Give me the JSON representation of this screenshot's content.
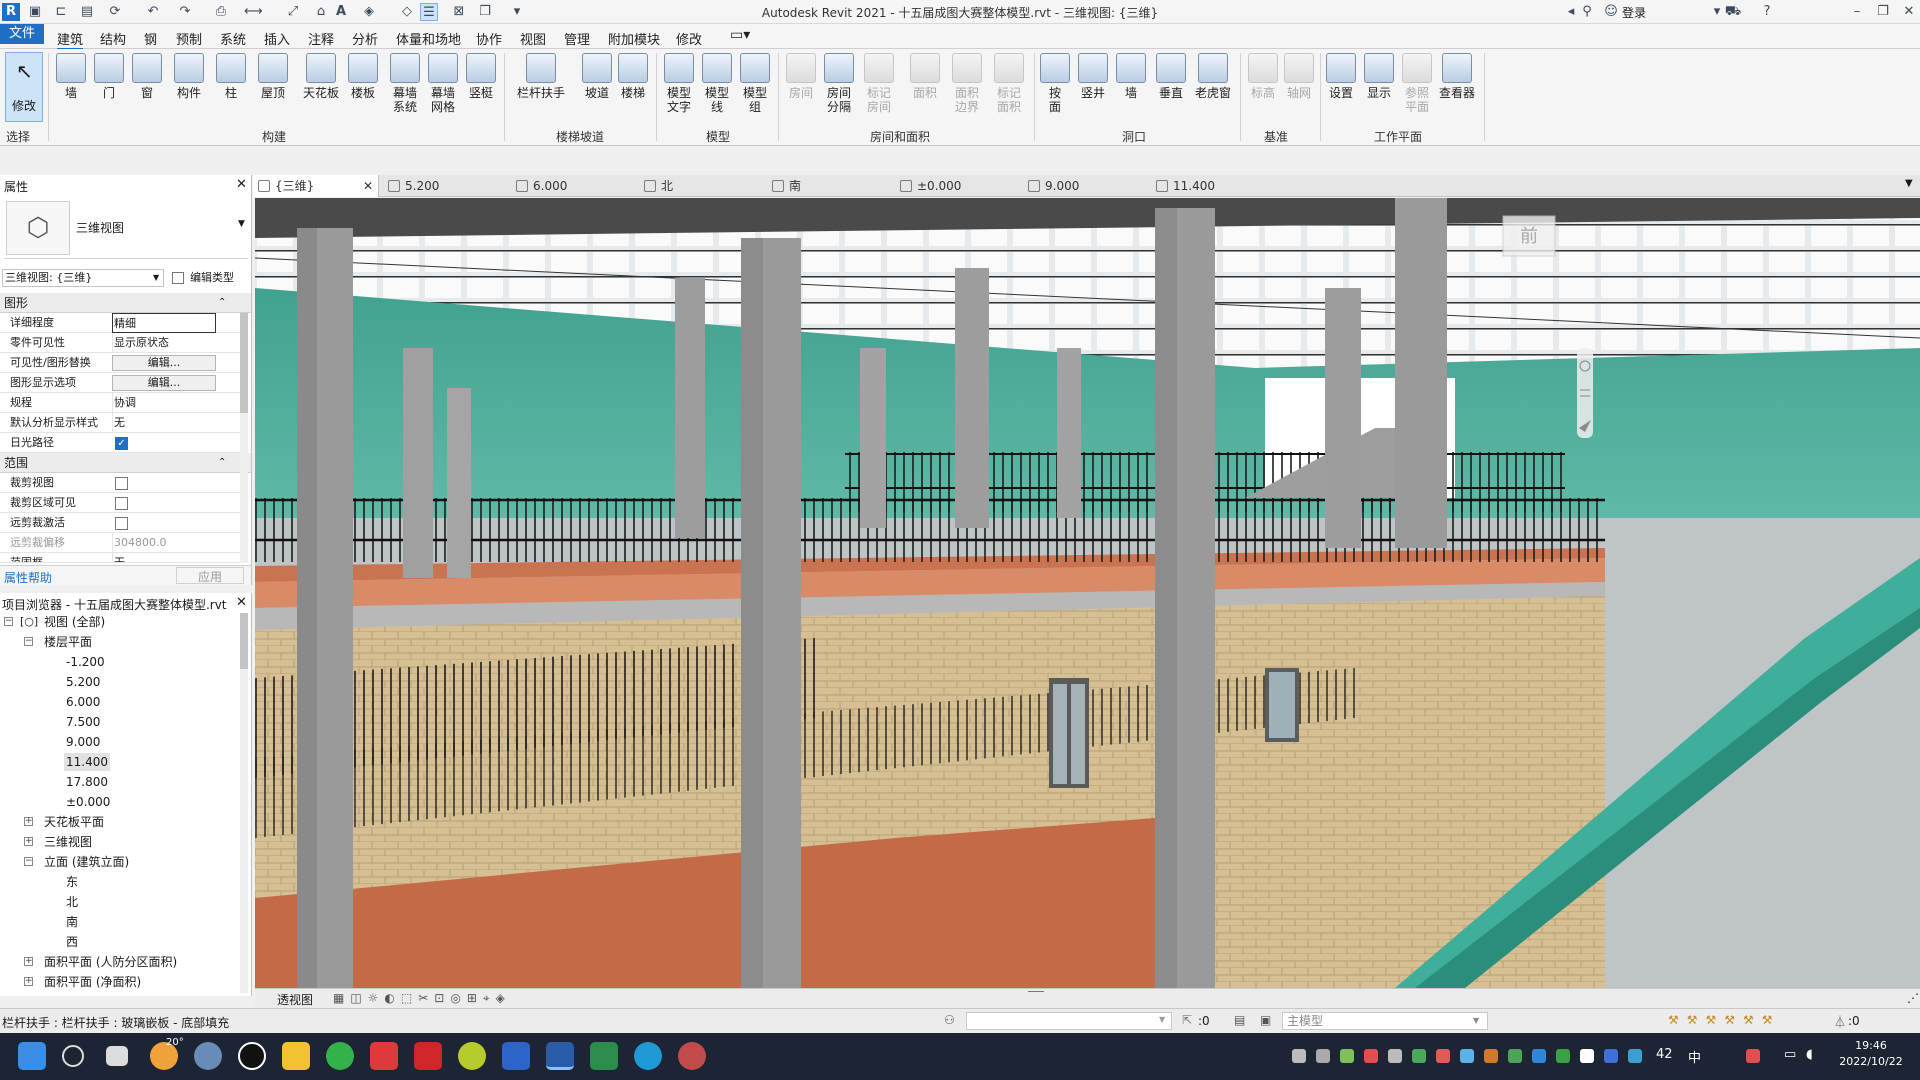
{
  "window": {
    "title": "Autodesk Revit 2021 - 十五届成图大赛整体模型.rvt - 三维视图: {三维}",
    "login_label": "登录"
  },
  "menu": {
    "file": "文件",
    "items": [
      "建筑",
      "结构",
      "钢",
      "预制",
      "系统",
      "插入",
      "注释",
      "分析",
      "体量和场地",
      "协作",
      "视图",
      "管理",
      "附加模块",
      "修改"
    ]
  },
  "ribbon": {
    "modify": "修改",
    "select_label": "选择",
    "buttons": [
      "墙",
      "门",
      "窗",
      "构件",
      "柱",
      "屋顶",
      "天花板",
      "楼板",
      "幕墙\n系统",
      "幕墙\n网格",
      "竖梃",
      "栏杆扶手",
      "坡道",
      "楼梯",
      "模型\n文字",
      "模型\n线",
      "模型\n组",
      "房间",
      "房间\n分隔",
      "标记\n房间",
      "面积",
      "面积\n边界",
      "标记\n面积",
      "按\n面",
      "竖井",
      "墙",
      "垂直",
      "老虎窗",
      "标高",
      "轴网",
      "设置",
      "显示",
      "参照\n平面",
      "查看器"
    ],
    "panels": [
      "构建",
      "楼梯坡道",
      "模型",
      "房间和面积",
      "洞口",
      "基准",
      "工作平面"
    ]
  },
  "view_tabs": [
    "{三维}",
    "5.200",
    "6.000",
    "北",
    "南",
    "±0.000",
    "9.000",
    "11.400"
  ],
  "properties": {
    "title": "属性",
    "type_name": "三维视图",
    "instance_selector": "三维视图: {三维}",
    "edit_type": "编辑类型",
    "section_graphics": "图形",
    "section_extents": "范围",
    "rows_graphics": [
      {
        "k": "详细程度",
        "v": "精细"
      },
      {
        "k": "零件可见性",
        "v": "显示原状态"
      },
      {
        "k": "可见性/图形替换",
        "v": "编辑..."
      },
      {
        "k": "图形显示选项",
        "v": "编辑..."
      },
      {
        "k": "规程",
        "v": "协调"
      },
      {
        "k": "默认分析显示样式",
        "v": "无"
      },
      {
        "k": "日光路径",
        "v": ""
      }
    ],
    "rows_extents": [
      {
        "k": "裁剪视图",
        "v": ""
      },
      {
        "k": "裁剪区域可见",
        "v": ""
      },
      {
        "k": "远剪裁激活",
        "v": ""
      },
      {
        "k": "远剪裁偏移",
        "v": "304800.0"
      },
      {
        "k": "范围框",
        "v": "无"
      }
    ],
    "help": "属性帮助",
    "apply": "应用"
  },
  "browser": {
    "title": "项目浏览器 - 十五届成图大赛整体模型.rvt",
    "root": "视图 (全部)",
    "floor_plans": "楼层平面",
    "levels": [
      "-1.200",
      "5.200",
      "6.000",
      "7.500",
      "9.000",
      "11.400",
      "17.800",
      "±0.000"
    ],
    "ceiling_plans": "天花板平面",
    "views_3d": "三维视图",
    "elevations": "立面 (建筑立面)",
    "elev_items": [
      "东",
      "北",
      "南",
      "西"
    ],
    "area_civil": "面积平面 (人防分区面积)",
    "area_net": "面积平面 (净面积)"
  },
  "viewport": {
    "viewcube_label": "前"
  },
  "viewbar": {
    "mode": "透视图"
  },
  "status": {
    "left": "栏杆扶手 : 栏杆扶手 : 玻璃嵌板 - 底部填充",
    "select_count": ":0",
    "model": "主模型",
    "filter": ":0"
  },
  "taskbar": {
    "time": "19:46",
    "date": "2022/10/22",
    "weather": "20°",
    "lang": "中"
  }
}
